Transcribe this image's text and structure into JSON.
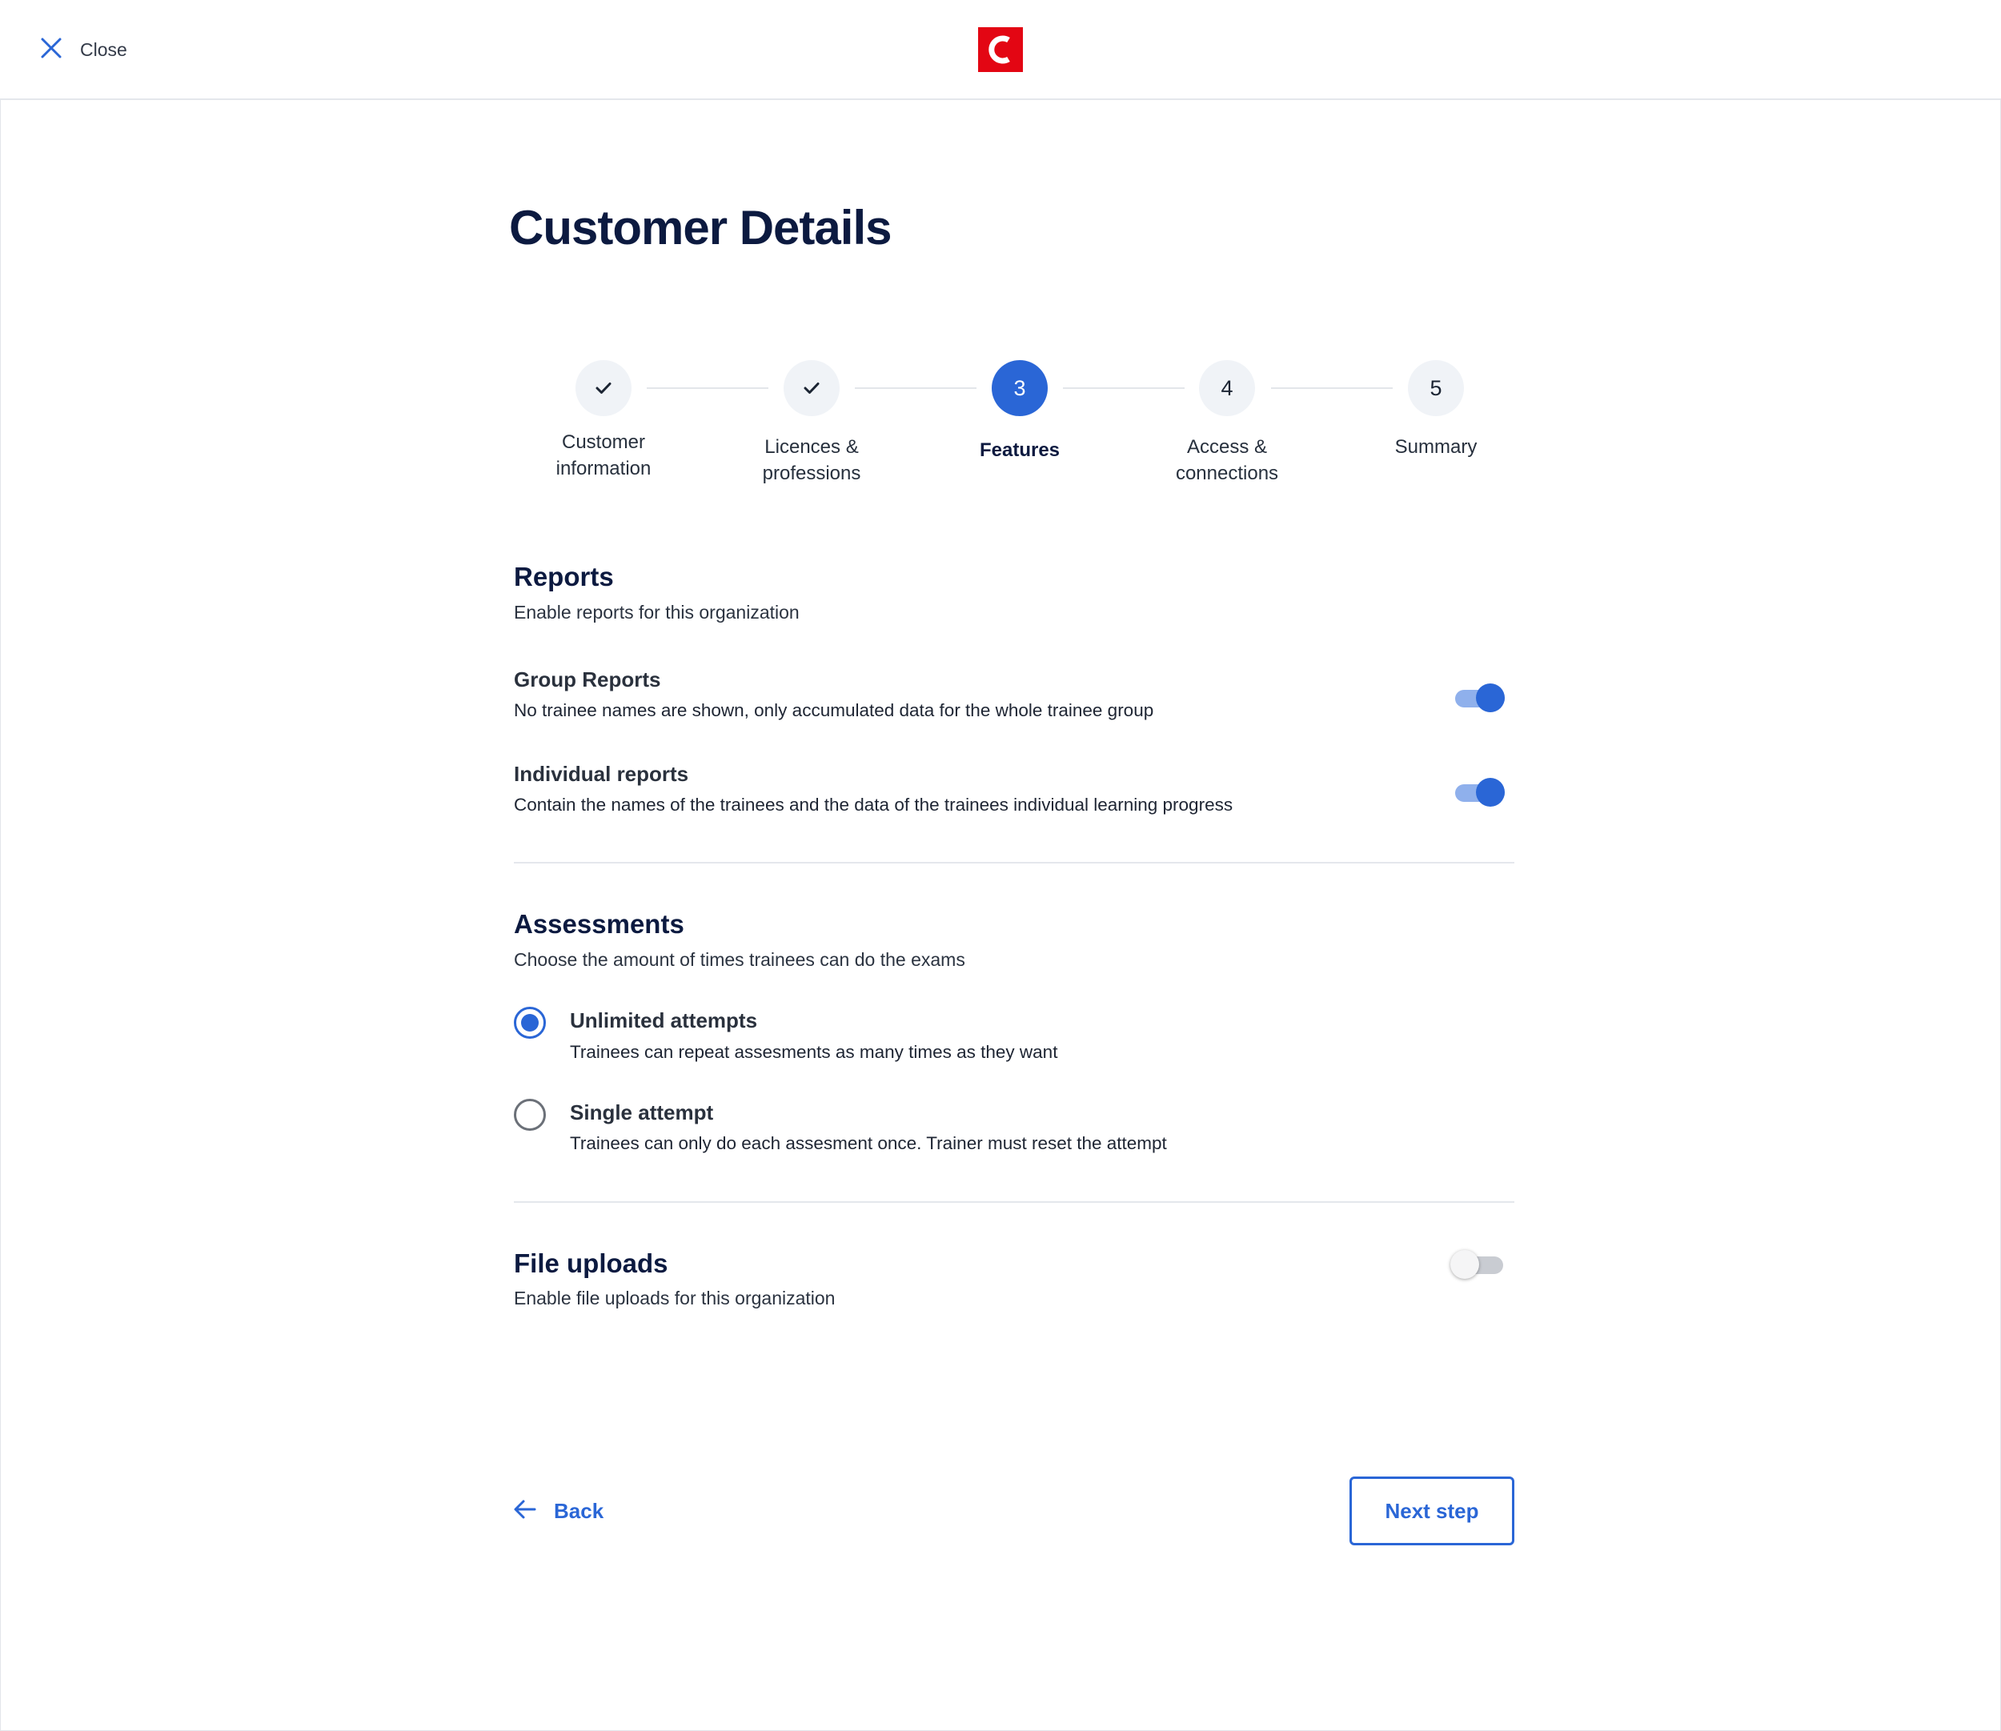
{
  "header": {
    "close_label": "Close",
    "logo_letter": "C"
  },
  "page": {
    "title": "Customer Details"
  },
  "stepper": {
    "steps": [
      {
        "number": "",
        "label_line1": "Customer",
        "label_line2": "information",
        "status": "done"
      },
      {
        "number": "",
        "label_line1": "Licences &",
        "label_line2": "professions",
        "status": "done"
      },
      {
        "number": "3",
        "label_line1": "Features",
        "label_line2": "",
        "status": "active"
      },
      {
        "number": "4",
        "label_line1": "Access &",
        "label_line2": "connections",
        "status": "pending"
      },
      {
        "number": "5",
        "label_line1": "Summary",
        "label_line2": "",
        "status": "pending"
      }
    ]
  },
  "reports": {
    "title": "Reports",
    "subtitle": "Enable reports for this organization",
    "items": [
      {
        "title": "Group Reports",
        "description": "No trainee names are shown, only accumulated data for the whole trainee group",
        "enabled": true
      },
      {
        "title": "Individual reports",
        "description": "Contain the names of the trainees and the data of the trainees individual learning progress",
        "enabled": true
      }
    ]
  },
  "assessments": {
    "title": "Assessments",
    "subtitle": "Choose the amount of times trainees can do the exams",
    "options": [
      {
        "title": "Unlimited attempts",
        "description": "Trainees can repeat assesments as many times as they want",
        "selected": true
      },
      {
        "title": "Single attempt",
        "description": "Trainees can only do each assesment once. Trainer must reset the attempt",
        "selected": false
      }
    ]
  },
  "file_uploads": {
    "title": "File uploads",
    "subtitle": "Enable file uploads for this organization",
    "enabled": false
  },
  "footer": {
    "back_label": "Back",
    "next_label": "Next step"
  },
  "colors": {
    "primary": "#2a66d6",
    "brand": "#e30613",
    "heading": "#0c1a40"
  }
}
